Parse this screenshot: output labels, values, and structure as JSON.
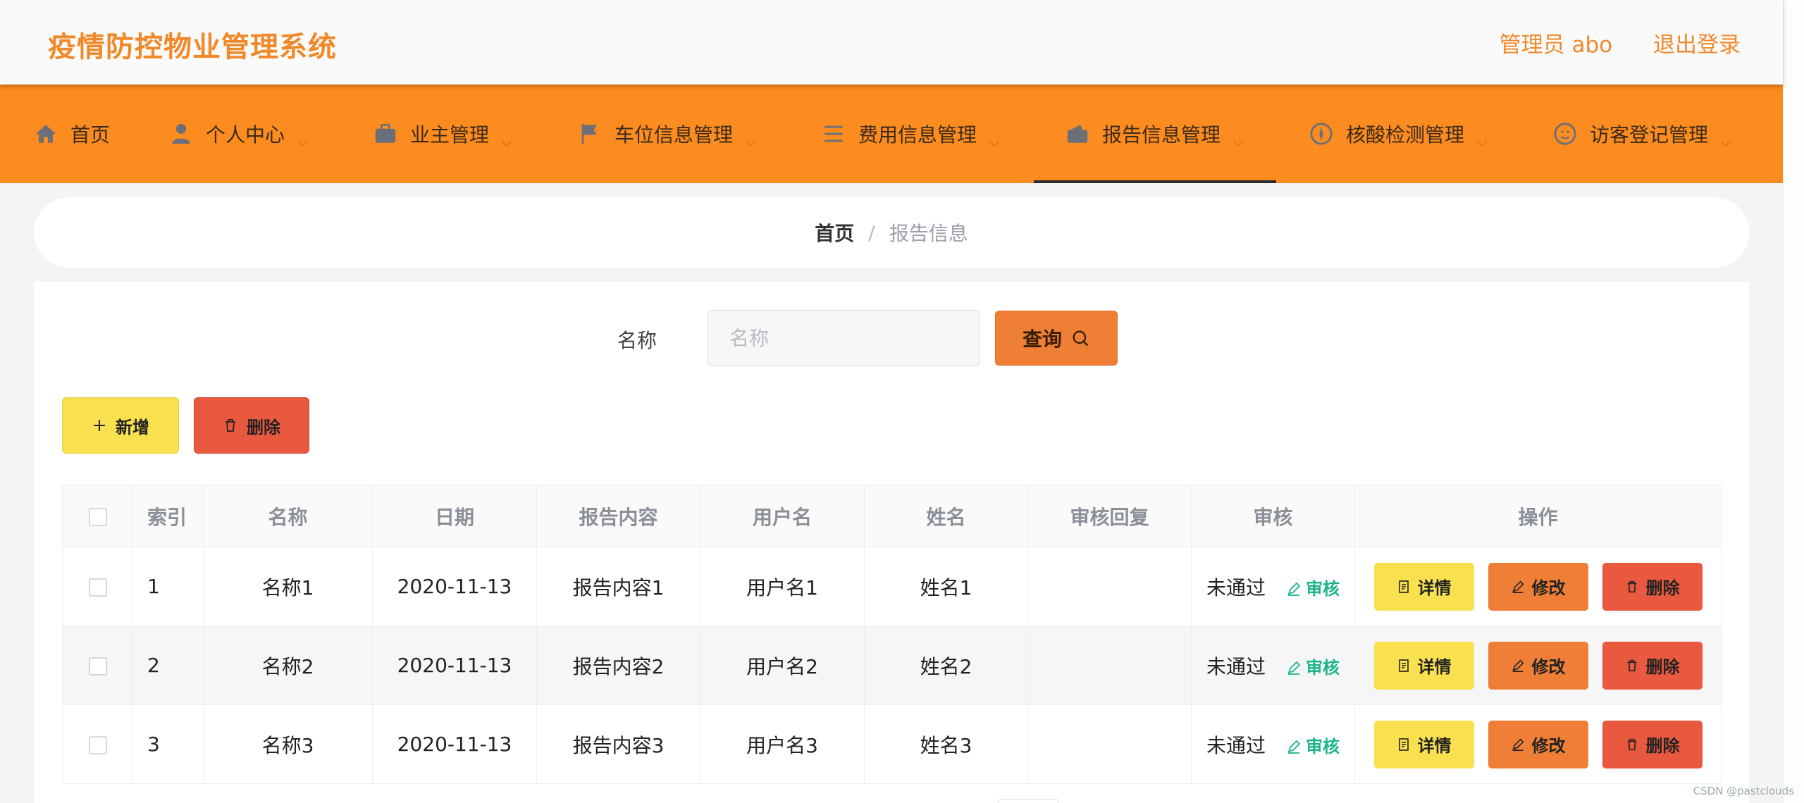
{
  "header": {
    "title": "疫情防控物业管理系统",
    "user_label": "管理员 abo",
    "logout_label": "退出登录"
  },
  "nav": {
    "items": [
      {
        "label": "首页",
        "icon": "home-icon"
      },
      {
        "label": "个人中心",
        "icon": "user-icon"
      },
      {
        "label": "业主管理",
        "icon": "briefcase-icon"
      },
      {
        "label": "车位信息管理",
        "icon": "flag-icon"
      },
      {
        "label": "费用信息管理",
        "icon": "list-icon"
      },
      {
        "label": "报告信息管理",
        "icon": "wallet-icon",
        "active": true
      },
      {
        "label": "核酸检测管理",
        "icon": "compass-icon"
      },
      {
        "label": "访客登记管理",
        "icon": "face-icon"
      }
    ]
  },
  "breadcrumb": {
    "home": "首页",
    "separator": "/",
    "current": "报告信息"
  },
  "search": {
    "label": "名称",
    "placeholder": "名称",
    "button_label": "查询"
  },
  "toolbar": {
    "add_label": "新增",
    "delete_label": "删除"
  },
  "table": {
    "columns": [
      "索引",
      "名称",
      "日期",
      "报告内容",
      "用户名",
      "姓名",
      "审核回复",
      "审核",
      "操作"
    ],
    "rows": [
      {
        "index": "1",
        "name": "名称1",
        "date": "2020-11-13",
        "content": "报告内容1",
        "username": "用户名1",
        "realname": "姓名1",
        "reply": "",
        "status": "未通过",
        "audit_label": "审核"
      },
      {
        "index": "2",
        "name": "名称2",
        "date": "2020-11-13",
        "content": "报告内容2",
        "username": "用户名2",
        "realname": "姓名2",
        "reply": "",
        "status": "未通过",
        "audit_label": "审核"
      },
      {
        "index": "3",
        "name": "名称3",
        "date": "2020-11-13",
        "content": "报告内容3",
        "username": "用户名3",
        "realname": "姓名3",
        "reply": "",
        "status": "未通过",
        "audit_label": "审核"
      }
    ],
    "actions": {
      "detail": "详情",
      "edit": "修改",
      "delete": "删除"
    }
  },
  "watermark": "CSDN @pastclouds",
  "colors": {
    "accent": "#fc8c20",
    "title": "#f0892a",
    "yellow": "#f8e04f",
    "orange": "#ef7f36",
    "red": "#e8593f",
    "audit_green": "#19b48a"
  }
}
